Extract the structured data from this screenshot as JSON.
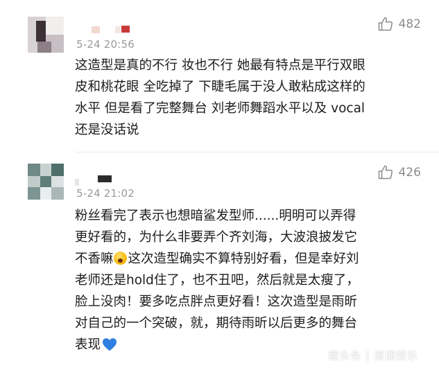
{
  "comments": [
    {
      "time": "5-24 20:56",
      "likes": "482",
      "lines": [
        "这造型是真的不行 妆也不行 她最有特点是平行双眼",
        "皮和桃花眼 全吃掉了 下睫毛属于没人敢粘成这样的",
        "水平 但是看了完整舞台 刘老师舞蹈水平以及 vocal",
        "还是没话说"
      ]
    },
    {
      "time": "5-24 21:02",
      "likes": "426",
      "lines": [
        "粉丝看完了表示也想暗鲨发型师......明明可以弄得",
        "更好看的，为什么非要弄个齐刘海，大波浪披发它",
        "不香嘛",
        "这次造型确实不算特别好看，但是幸好刘",
        "老师还是hold住了，也不丑吧，然后就是太瘦了，",
        "脸上没肉！要多吃点胖点更好看！这次造型是雨昕",
        "对自己的一个突破，就，期待雨昕以后更多的舞台",
        "表现"
      ]
    }
  ],
  "icons": {
    "like": "thumbs-up-icon",
    "emoji": "face-screaming-icon",
    "heart": "blue-heart-icon"
  },
  "colors": {
    "meta_gray": "#9a9a9a",
    "heart_blue": "#2f7fe0"
  },
  "watermark": "趣头条 | 潇湘娱乐"
}
